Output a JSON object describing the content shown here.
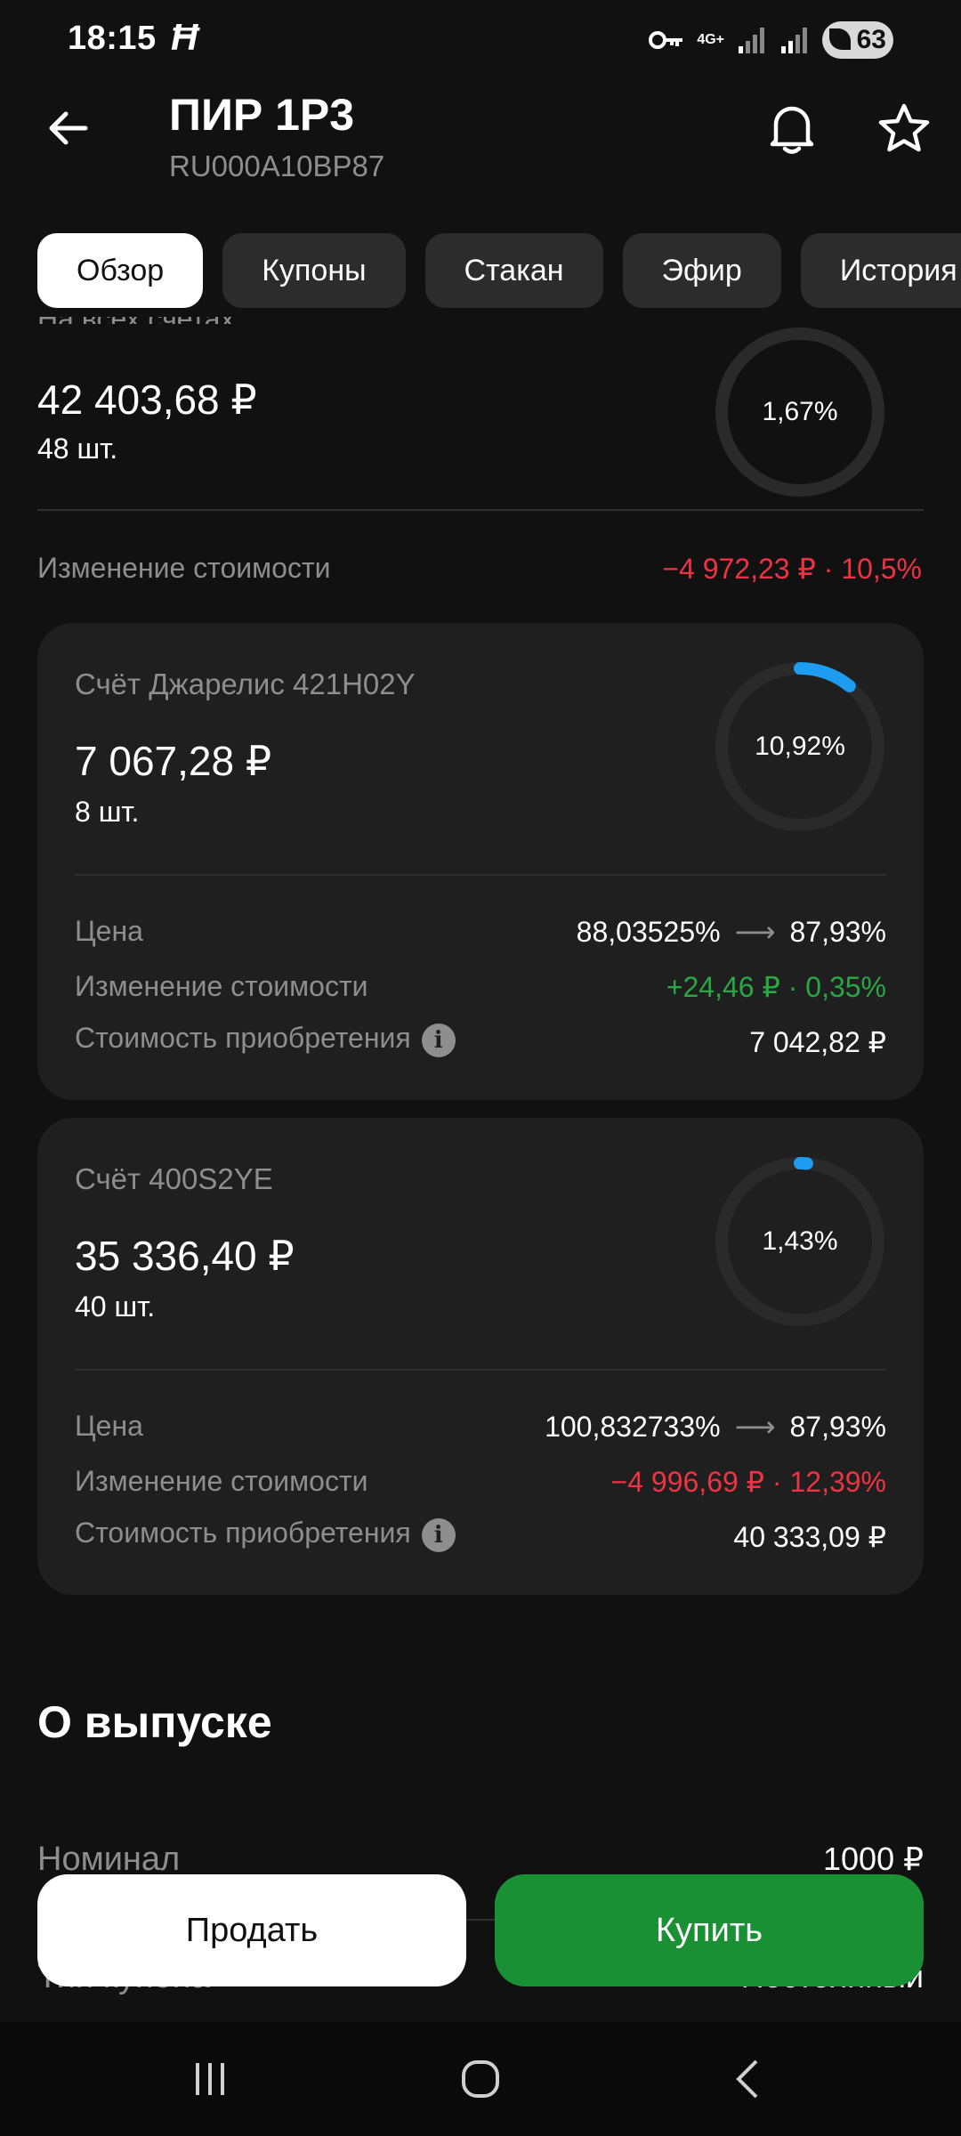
{
  "status_bar": {
    "time": "18:15",
    "network": "4G+",
    "battery": "63"
  },
  "header": {
    "title": "ПИР 1Р3",
    "isin": "RU000A10BP87"
  },
  "tabs": [
    {
      "label": "Обзор",
      "active": true
    },
    {
      "label": "Купоны",
      "active": false
    },
    {
      "label": "Стакан",
      "active": false
    },
    {
      "label": "Эфир",
      "active": false
    },
    {
      "label": "История",
      "active": false
    }
  ],
  "total": {
    "label": "На всех счетах",
    "amount": "42 403,68 ₽",
    "quantity": "48 шт.",
    "share": "1,67%",
    "change_label": "Изменение стоимости",
    "change_value": "−4 972,23 ₽ · 10,5%"
  },
  "accounts": [
    {
      "title": "Счёт Джарелис 421H02Y",
      "amount": "7 067,28 ₽",
      "quantity": "8 шт.",
      "share": "10,92%",
      "share_fraction": 0.1092,
      "price_label": "Цена",
      "price_from": "88,03525%",
      "price_to": "87,93%",
      "change_label": "Изменение стоимости",
      "change_value": "+24,46 ₽ · 0,35%",
      "cost_label": "Стоимость приобретения",
      "cost_value": "7 042,82 ₽"
    },
    {
      "title": "Счёт 400S2YE",
      "amount": "35 336,40 ₽",
      "quantity": "40 шт.",
      "share": "1,43%",
      "share_fraction": 0.0143,
      "price_label": "Цена",
      "price_from": "100,832733%",
      "price_to": "87,93%",
      "change_label": "Изменение стоимости",
      "change_value": "−4 996,69 ₽ · 12,39%",
      "cost_label": "Стоимость приобретения",
      "cost_value": "40 333,09 ₽"
    }
  ],
  "about": {
    "title": "О выпуске",
    "nominal_label": "Номинал",
    "nominal_value": "1000 ₽",
    "coupon_type_label": "Тип купона",
    "coupon_type_value": "Постоянный"
  },
  "actions": {
    "sell": "Продать",
    "buy": "Купить"
  },
  "colors": {
    "negative": "#ee3344",
    "positive": "#27a844",
    "ring_accent": "#1e9cf0",
    "buy_button": "#1a9035"
  }
}
